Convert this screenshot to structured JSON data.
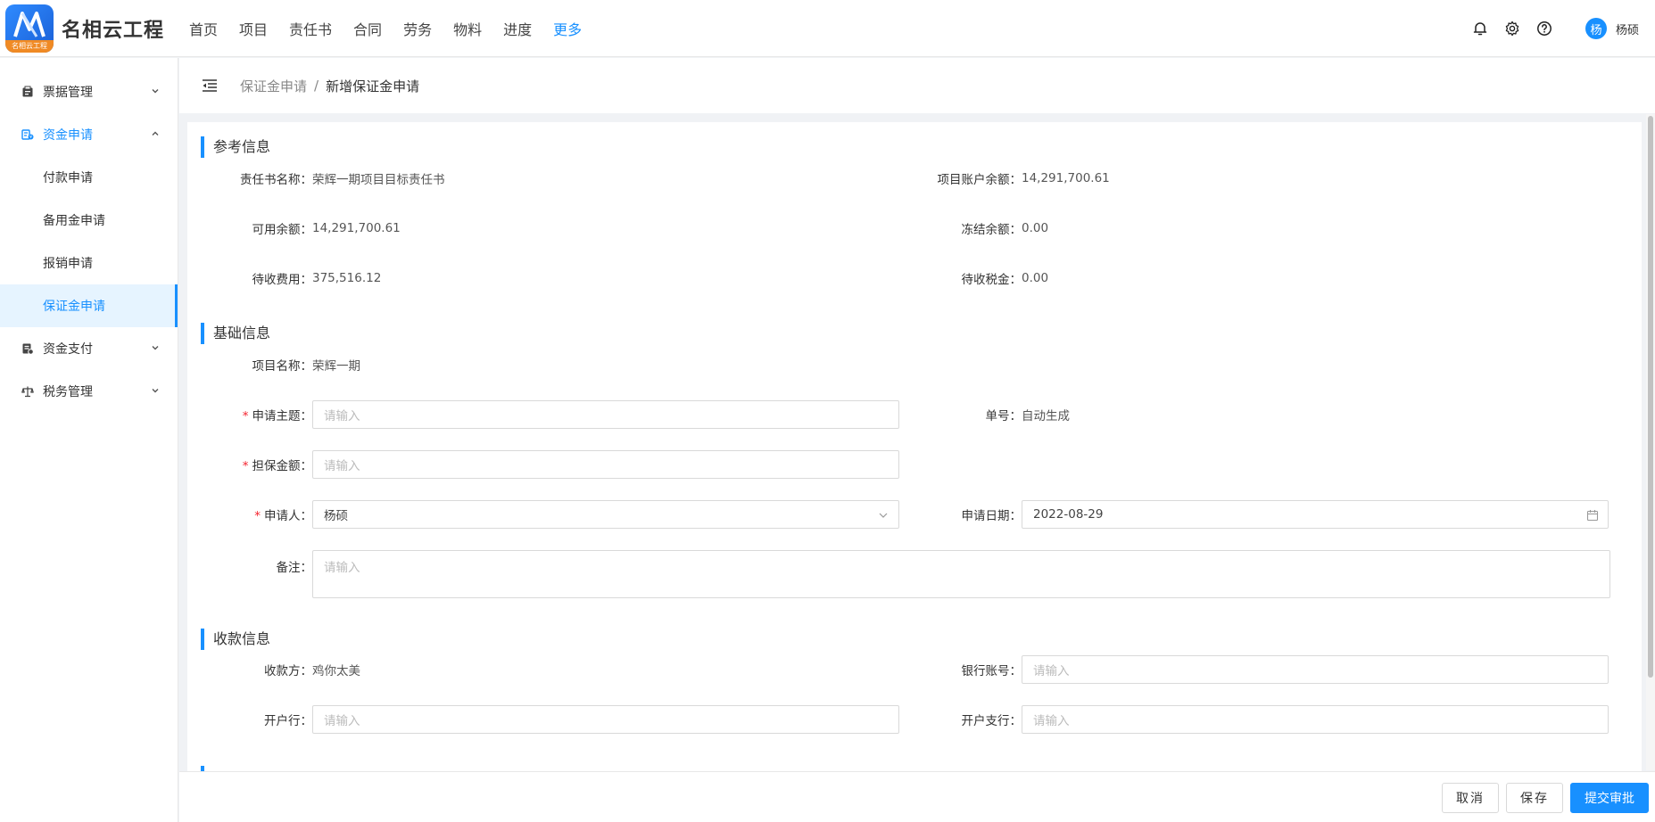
{
  "app": {
    "brand": "名相云工程",
    "logo_caption": "名相云工程"
  },
  "nav": {
    "items": [
      "首页",
      "项目",
      "责任书",
      "合同",
      "劳务",
      "物料",
      "进度",
      "更多"
    ],
    "active_index": 7
  },
  "user": {
    "avatar_char": "杨",
    "name": "杨硕"
  },
  "sidebar": {
    "groups": [
      {
        "label": "票据管理",
        "icon": "receipt-icon"
      },
      {
        "label": "资金申请",
        "icon": "fund-apply-icon"
      },
      {
        "label": "资金支付",
        "icon": "payment-icon"
      },
      {
        "label": "税务管理",
        "icon": "tax-scale-icon"
      }
    ],
    "sub_items": [
      "付款申请",
      "备用金申请",
      "报销申请",
      "保证金申请"
    ]
  },
  "breadcrumb": {
    "parent": "保证金申请",
    "separator": "/",
    "current": "新增保证金申请"
  },
  "reference": {
    "title": "参考信息",
    "responsibility_label": "责任书名称：",
    "responsibility_value": "荣辉一期项目目标责任书",
    "account_balance_label": "项目账户余额：",
    "account_balance_value": "14,291,700.61",
    "available_label": "可用余额：",
    "available_value": "14,291,700.61",
    "frozen_label": "冻结余额：",
    "frozen_value": "0.00",
    "pending_fee_label": "待收费用：",
    "pending_fee_value": "375,516.12",
    "pending_tax_label": "待收税金：",
    "pending_tax_value": "0.00"
  },
  "basic": {
    "title": "基础信息",
    "project_label": "项目名称：",
    "project_value": "荣辉一期",
    "subject_label": "申请主题：",
    "subject_placeholder": "请输入",
    "order_no_label": "单号：",
    "order_no_value": "自动生成",
    "amount_label": "担保金额：",
    "amount_placeholder": "请输入",
    "applicant_label": "申请人：",
    "applicant_value": "杨硕",
    "date_label": "申请日期：",
    "date_value": "2022-08-29",
    "remark_label": "备注：",
    "remark_placeholder": "请输入"
  },
  "receipt": {
    "title": "收款信息",
    "payee_label": "收款方：",
    "payee_value": "鸡你太美",
    "bank_account_label": "银行账号：",
    "bank_account_placeholder": "请输入",
    "bank_label": "开户行：",
    "bank_placeholder": "请输入",
    "branch_label": "开户支行：",
    "branch_placeholder": "请输入"
  },
  "footer": {
    "cancel": "取消",
    "save": "保存",
    "submit": "提交审批"
  },
  "colors": {
    "accent": "#1890ff",
    "required": "#f5222d",
    "logo_orange": "#f08a24"
  }
}
